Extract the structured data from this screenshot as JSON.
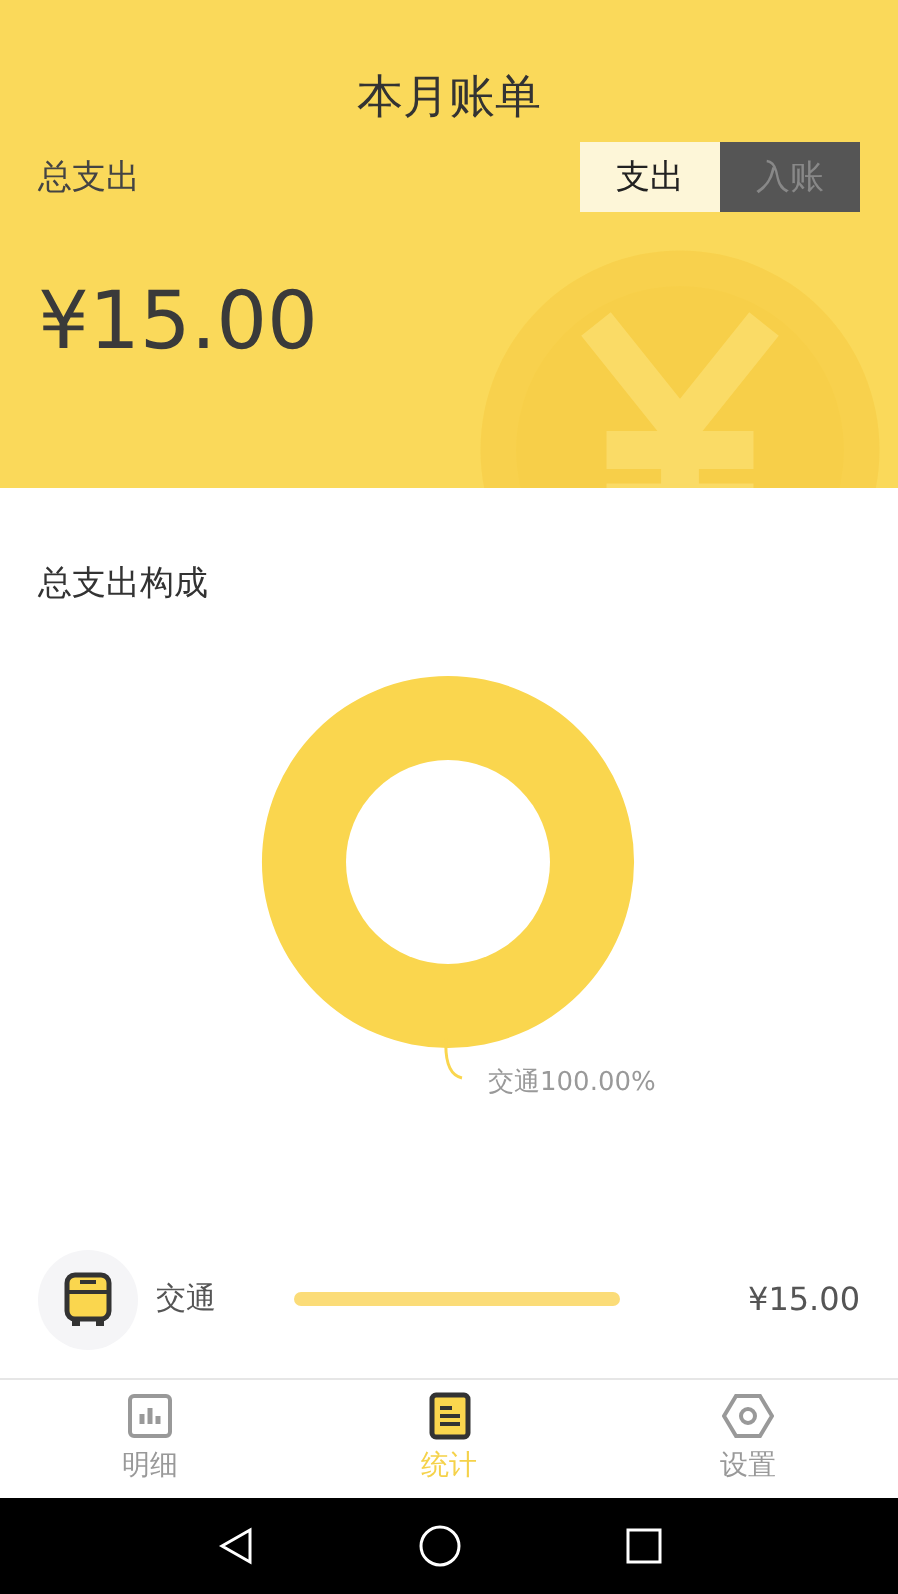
{
  "header": {
    "title": "本月账单",
    "total_label": "总支出",
    "amount": "¥15.00"
  },
  "toggle": [
    {
      "label": "支出",
      "selected": true
    },
    {
      "label": "入账",
      "selected": false
    }
  ],
  "composition": {
    "title": "总支出构成",
    "chart_data": {
      "type": "donut",
      "categories": [
        "交通100.00%"
      ],
      "values": [
        100
      ]
    }
  },
  "categories": [
    {
      "name": "交通",
      "amount": "¥15.00"
    }
  ],
  "tabs": [
    {
      "label": "明细",
      "selected": false
    },
    {
      "label": "统计",
      "selected": true
    },
    {
      "label": "设置",
      "selected": false
    }
  ]
}
